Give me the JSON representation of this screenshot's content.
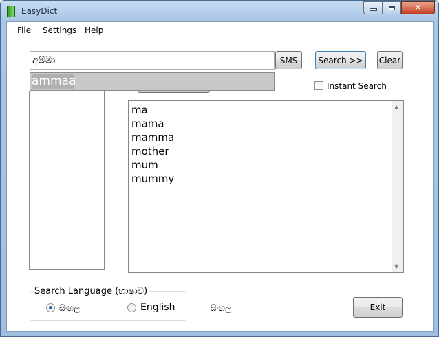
{
  "window": {
    "title": "EasyDict",
    "controls": {
      "minimize": "–",
      "maximize": "□",
      "close": "✕"
    }
  },
  "menu": [
    "File",
    "Settings",
    "Help"
  ],
  "search": {
    "input_value": "අම්මා",
    "autocomplete_suggestion": "ammaa",
    "sms_label": "SMS",
    "search_label": "Search >>",
    "clear_label": "Clear",
    "instant_search_label": "Instant Search",
    "instant_search_checked": false
  },
  "results": [
    "ma",
    "mama",
    "mamma",
    "mother",
    "mum",
    "mummy"
  ],
  "language": {
    "group_label": "Search Language (භාෂාව)",
    "options": [
      {
        "label": "සිංහල",
        "selected": true
      },
      {
        "label": "English",
        "selected": false
      }
    ],
    "current_label": "සිංහල"
  },
  "exit_label": "Exit",
  "icons": {
    "up": "up-arrow-icon",
    "down": "down-arrow-icon",
    "app": "app-icon"
  }
}
